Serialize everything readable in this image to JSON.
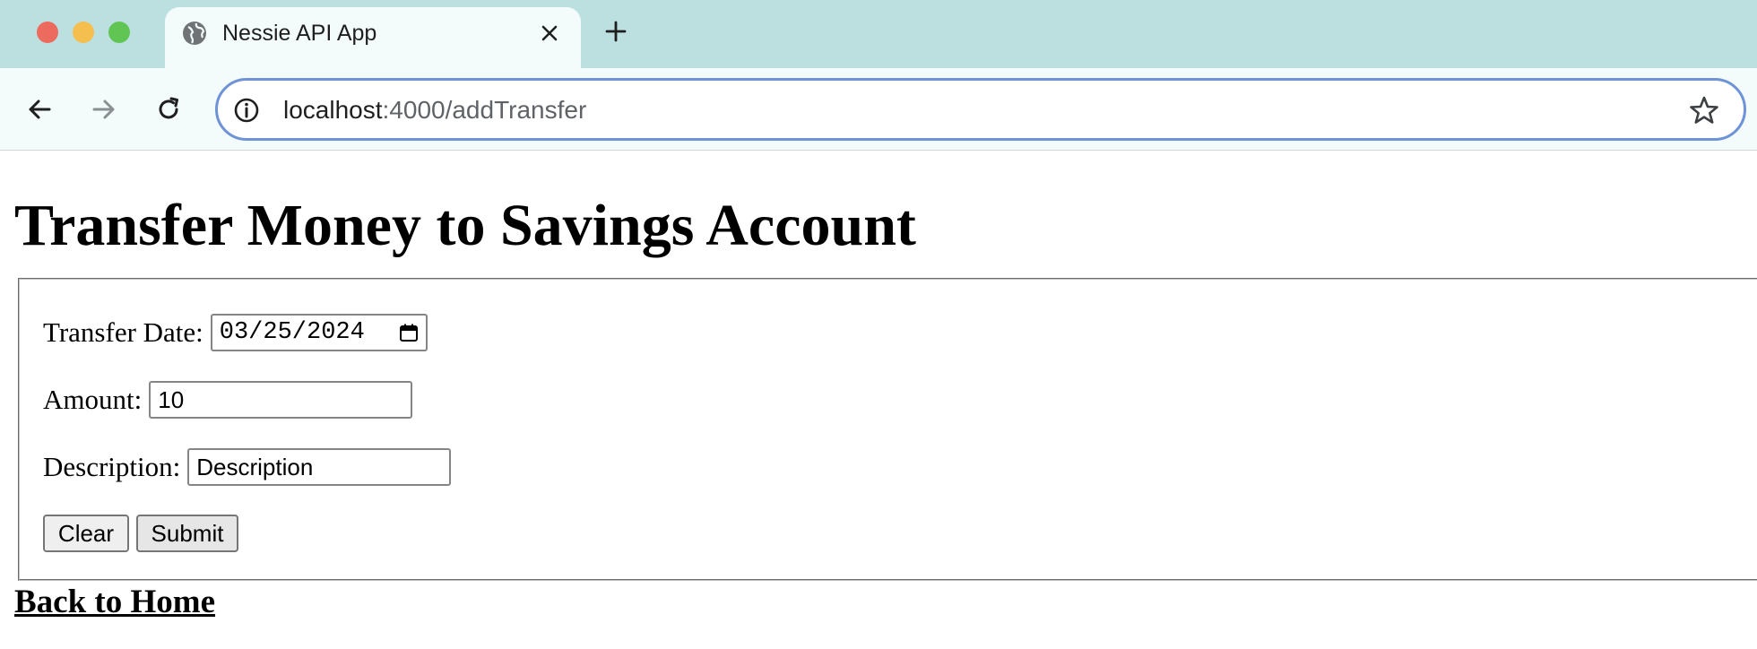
{
  "browser": {
    "tab": {
      "title": "Nessie API App",
      "favicon": "globe-icon",
      "close_icon": "close-icon"
    },
    "new_tab_icon": "plus-icon",
    "nav": {
      "back_icon": "arrow-left-icon",
      "forward_icon": "arrow-right-icon",
      "reload_icon": "reload-icon"
    },
    "address_bar": {
      "info_icon": "info-icon",
      "host": "localhost",
      "path": ":4000/addTransfer",
      "bookmark_icon": "star-icon"
    },
    "colors": {
      "tabstrip": "#bcdfe0",
      "toolbar": "#f3fbfb",
      "omnibox_focus": "#6e93d6"
    }
  },
  "page": {
    "heading": "Transfer Money to Savings Account",
    "form": {
      "date_label": "Transfer Date:",
      "date_value": "03/25/2024",
      "amount_label": "Amount:",
      "amount_value": "10",
      "description_label": "Description:",
      "description_placeholder": "Description",
      "clear_label": "Clear",
      "submit_label": "Submit"
    },
    "back_link": "Back to Home"
  }
}
